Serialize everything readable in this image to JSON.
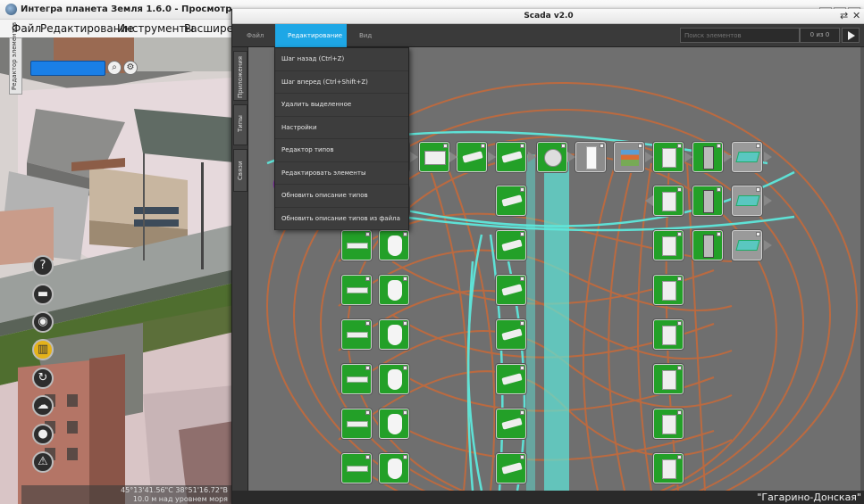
{
  "back_app": {
    "title": "Интегра планета Земля 1.6.0 - Просмотр",
    "menu": [
      "Файл",
      "Редактирование",
      "Инструменты",
      "Расширени"
    ],
    "left_tab": "Редактор элементов",
    "coords_line1": "45°13'41.56\"С 38°51'16.72\"В",
    "coords_line2": "10.0 м над уровнем моря",
    "tool_icons": [
      "help-icon",
      "vehicle-icon",
      "camera-icon",
      "building-icon",
      "rotate-icon",
      "crowd-icon",
      "globe-icon",
      "alarm-icon"
    ]
  },
  "scada": {
    "title": "Scada v2.0",
    "controls": {
      "restore": "⇄",
      "close": "✕"
    },
    "menu": [
      "Файл",
      "Редактирование",
      "Вид"
    ],
    "active_menu": "Редактирование",
    "search_placeholder": "Поиск элементов",
    "search_count": "0 из 0",
    "side_tabs": [
      "Приложения",
      "Типы",
      "Связи"
    ],
    "status_text": "\"Гагарино-Донская\"",
    "accent_color": "#1ea7e6",
    "node_green": "#23a028",
    "link_orange": "#c46a3c",
    "link_cyan": "#5ee8dc"
  },
  "dropdown": {
    "items": [
      "Шаг назад (Ctrl+Z)",
      "Шаг вперед (Ctrl+Shift+Z)",
      "Удалить выделенное",
      "Настройки",
      "Редактор типов",
      "Редактировать элементы",
      "Обновить описание типов",
      "Обновить описание типов из файла"
    ]
  }
}
